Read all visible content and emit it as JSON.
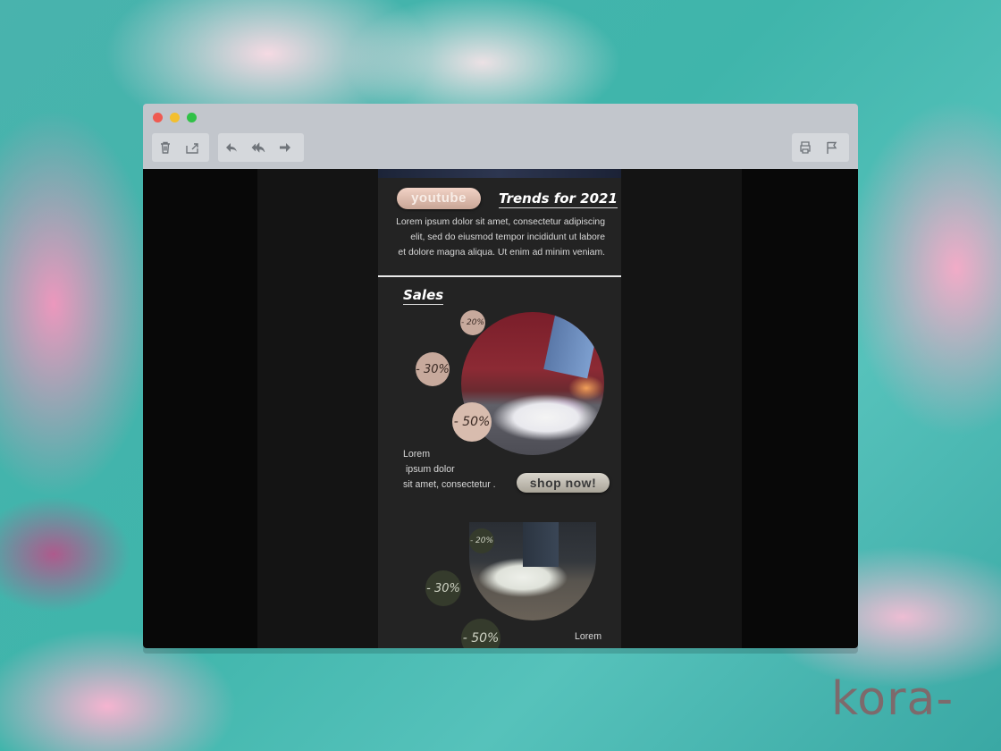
{
  "toolbar": {
    "left_group_1": [
      "trash-icon",
      "share-icon"
    ],
    "left_group_2": [
      "reply-icon",
      "reply-all-icon",
      "forward-icon"
    ],
    "right_group": [
      "print-icon",
      "flag-icon"
    ]
  },
  "email": {
    "youtube_button": "youtube",
    "trends_title": "Trends for 2021",
    "intro_lines": [
      "Lorem ipsum dolor sit amet, consectetur adipiscing",
      "elit, sed do eiusmod tempor incididunt ut labore",
      "et dolore magna aliqua. Ut enim ad minim veniam."
    ],
    "sales_title": "Sales",
    "discounts_1": [
      "- 20%",
      "- 30%",
      "- 50%"
    ],
    "product_1_text": "Lorem\n ipsum dolor\nsit amet, consectetur .",
    "shop_button": "shop now!",
    "discounts_2": [
      "- 20%",
      "- 30%",
      "- 50%"
    ],
    "product_2_text": "Lorem"
  },
  "brand": "kora-",
  "colors": {
    "accent_pink": "#c7a99c",
    "accent_green": "#353b2c",
    "email_bg": "#232323",
    "window_chrome": "#c2c6cc"
  }
}
